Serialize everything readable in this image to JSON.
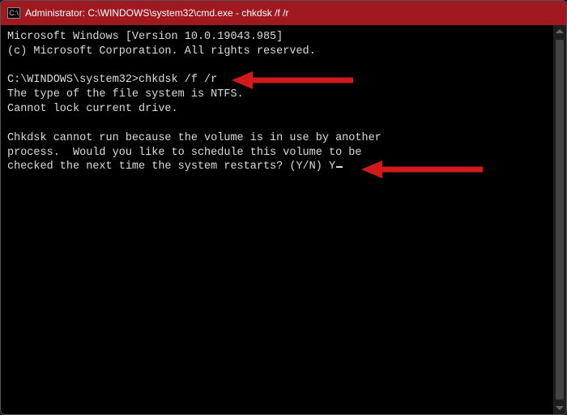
{
  "titlebar": {
    "icon_glyph": "C:\\",
    "title": "Administrator: C:\\WINDOWS\\system32\\cmd.exe - chkdsk  /f /r"
  },
  "terminal": {
    "line1": "Microsoft Windows [Version 10.0.19043.985]",
    "line2": "(c) Microsoft Corporation. All rights reserved.",
    "blank1": "",
    "prompt_path": "C:\\WINDOWS\\system32>",
    "command": "chkdsk /f /r",
    "line3": "The type of the file system is NTFS.",
    "line4": "Cannot lock current drive.",
    "blank2": "",
    "line5": "Chkdsk cannot run because the volume is in use by another",
    "line6": "process.  Would you like to schedule this volume to be",
    "line7": "checked the next time the system restarts? (Y/N) ",
    "input": "Y"
  },
  "colors": {
    "accent": "#a01820",
    "arrow": "#d11a1a"
  }
}
